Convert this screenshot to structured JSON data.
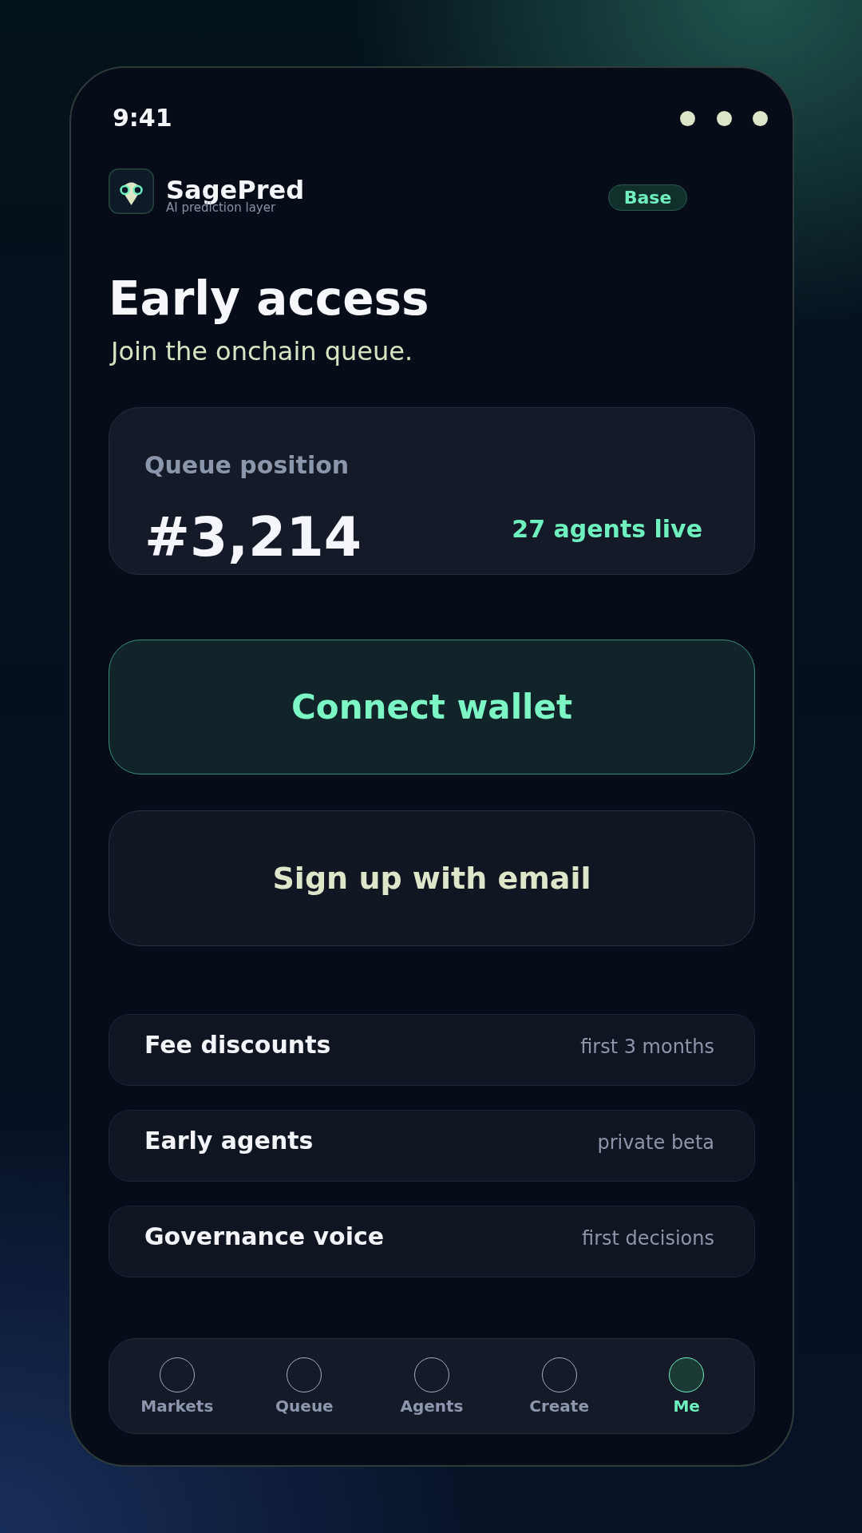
{
  "status_bar": {
    "time": "9:41"
  },
  "header": {
    "app_name": "SagePred",
    "tagline": "AI prediction layer",
    "badge": "Base"
  },
  "hero": {
    "title": "Early access",
    "subtitle": "Join the onchain queue."
  },
  "queue_card": {
    "label": "Queue position",
    "position": "#3,214",
    "agents_live": "27 agents live"
  },
  "actions": [
    {
      "kind": "primary",
      "label": "Connect wallet"
    },
    {
      "kind": "secondary",
      "label": "Sign up with email"
    }
  ],
  "perks": [
    {
      "title": "Fee discounts",
      "detail": "first 3 months"
    },
    {
      "title": "Early agents",
      "detail": "private beta"
    },
    {
      "title": "Governance voice",
      "detail": "first decisions"
    }
  ],
  "bottom_nav": {
    "tabs": [
      {
        "label": "Markets",
        "selected": false
      },
      {
        "label": "Queue",
        "selected": false
      },
      {
        "label": "Agents",
        "selected": false
      },
      {
        "label": "Create",
        "selected": false
      },
      {
        "label": "Me",
        "selected": true
      }
    ]
  }
}
